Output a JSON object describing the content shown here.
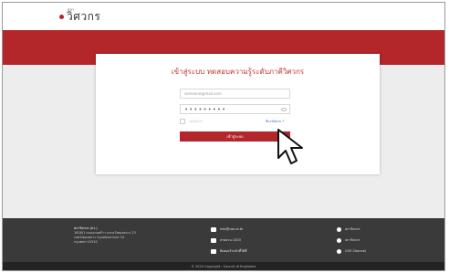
{
  "header": {
    "logo_small": "สภา",
    "logo_text": "วิศวกร"
  },
  "login": {
    "title": "เข้าสู่ระบบ ทดสอบความรู้ระดับภาคีวิศวกร",
    "email_value": "someone@mail.com",
    "password_mask": "•••••••••",
    "remember_label": "จดจำฉันไว้",
    "forgot_link": "ลืมรหัสผ่าน ?",
    "login_button": "เข้าสู่ระบบ"
  },
  "footer": {
    "address_title": "สภาวิศวกร (สว.)",
    "address_lines": [
      "1616/1 ถนนลาดพร้าว แขวงวังทองหลาง 23",
      "เขตวังทองหลาง กรุงเทพมหานคร 10",
      "กรุงเทพฯ 10310"
    ],
    "contacts": [
      {
        "icon": "mail-icon",
        "text": "info@coe.or.th"
      },
      {
        "icon": "phone-icon",
        "text": "สายด่วน 1303"
      },
      {
        "icon": "document-icon",
        "text": "ติดต่อเจ้าหน้าที่ได้ที่"
      }
    ],
    "socials": [
      {
        "icon": "facebook-icon",
        "text": "สภาวิศวกร"
      },
      {
        "icon": "line-icon",
        "text": "สภาวิศวกร"
      },
      {
        "icon": "youtube-icon",
        "text": "COE Channel"
      }
    ],
    "copyright": "© 2020 Copyright : Council of Engineers"
  },
  "colors": {
    "brand_red": "#b3262a",
    "footer_dark": "#3a3a3a",
    "footer_bottom": "#232323",
    "content_gray": "#ededed"
  }
}
